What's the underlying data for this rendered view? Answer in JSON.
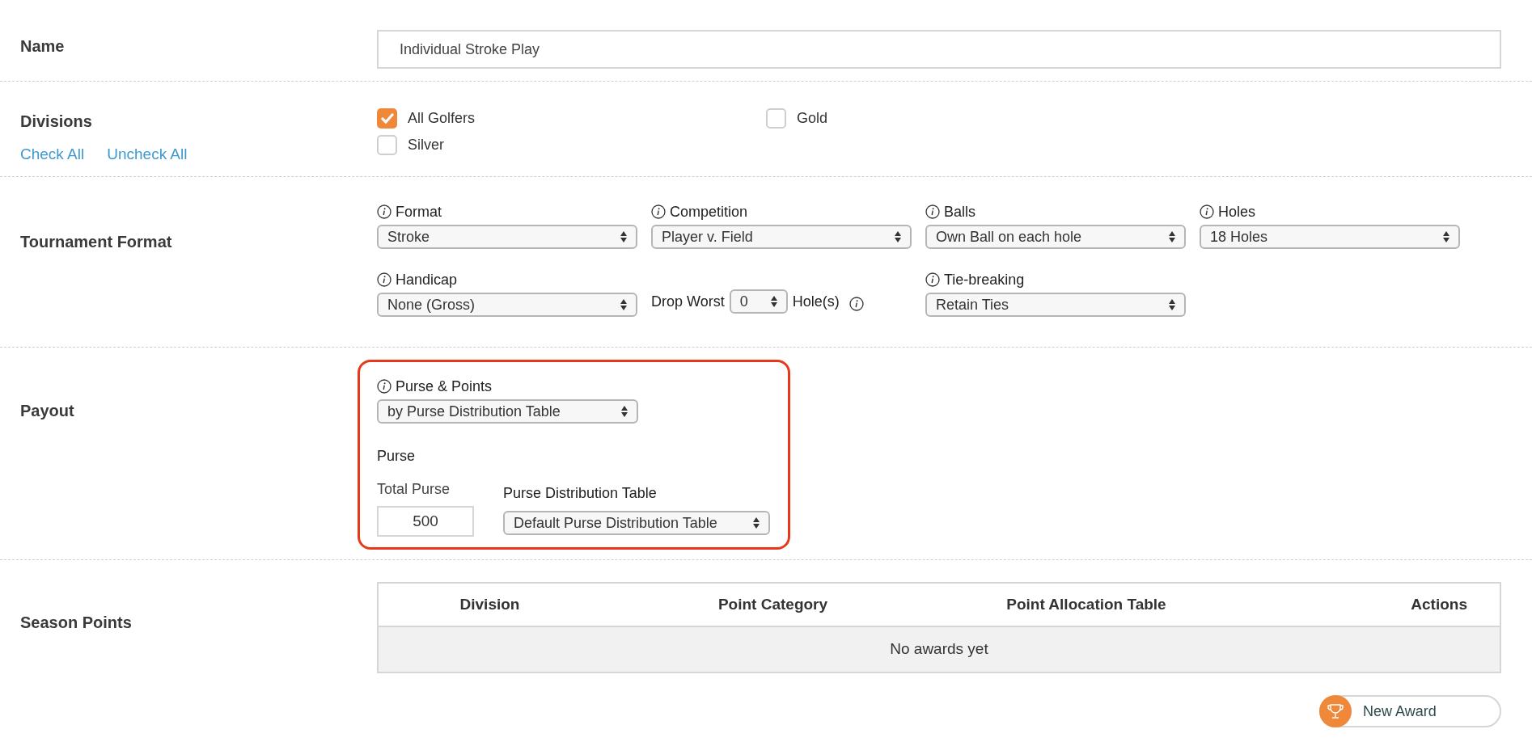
{
  "name": {
    "label": "Name",
    "value": "Individual Stroke Play"
  },
  "divisions": {
    "label": "Divisions",
    "check_all": "Check All",
    "uncheck_all": "Uncheck All",
    "options": [
      {
        "label": "All Golfers",
        "checked": true
      },
      {
        "label": "Gold",
        "checked": false
      },
      {
        "label": "Silver",
        "checked": false
      }
    ]
  },
  "tournament_format": {
    "label": "Tournament Format",
    "fields": [
      {
        "kind": "select",
        "label": "Format",
        "value": "Stroke"
      },
      {
        "kind": "select",
        "label": "Competition",
        "value": "Player v. Field"
      },
      {
        "kind": "select",
        "label": "Balls",
        "value": "Own Ball on each hole"
      },
      {
        "kind": "select",
        "label": "Holes",
        "value": "18 Holes"
      },
      {
        "kind": "select",
        "label": "Handicap",
        "value": "None (Gross)"
      },
      {
        "kind": "drop",
        "label": "Drop Worst",
        "value": "0",
        "suffix": "Hole(s)"
      },
      {
        "kind": "select",
        "label": "Tie-breaking",
        "value": "Retain Ties"
      }
    ]
  },
  "payout": {
    "label": "Payout",
    "purse_points": {
      "label": "Purse & Points",
      "value": "by Purse Distribution Table"
    },
    "purse_heading": "Purse",
    "total_purse": {
      "label": "Total Purse",
      "value": "500"
    },
    "distribution_table": {
      "label": "Purse Distribution Table",
      "value": "Default Purse Distribution Table"
    }
  },
  "season_points": {
    "label": "Season Points",
    "table": {
      "columns": [
        "Division",
        "Point Category",
        "Point Allocation Table",
        "Actions"
      ],
      "empty_message": "No awards yet"
    },
    "new_award_button": "New Award"
  }
}
